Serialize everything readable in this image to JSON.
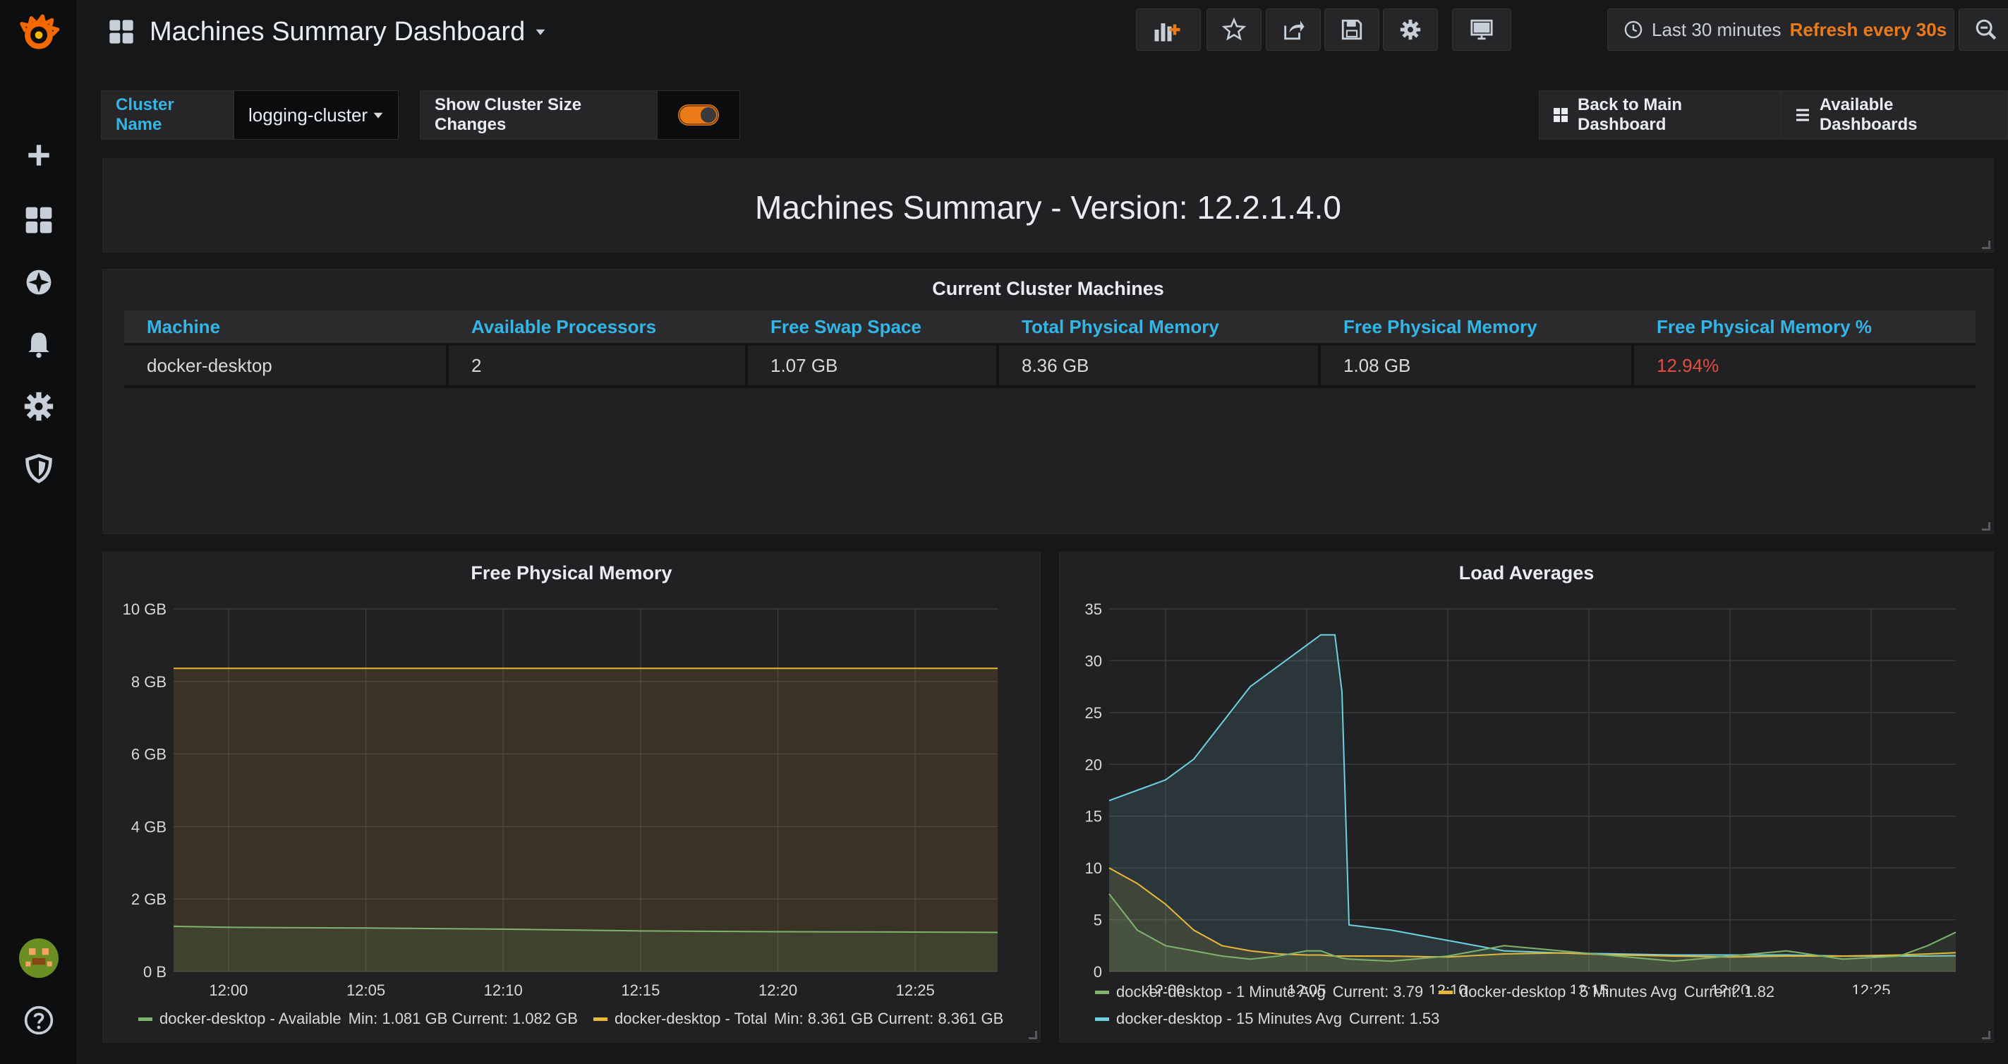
{
  "dashboard": {
    "title": "Machines Summary Dashboard",
    "time_range": "Last 30 minutes",
    "refresh": "Refresh every 30s"
  },
  "variables": {
    "cluster_label": "Cluster Name",
    "cluster_value": "logging-cluster",
    "toggle_label": "Show Cluster Size Changes",
    "toggle_on": true
  },
  "links": {
    "back": "Back to Main Dashboard",
    "available": "Available Dashboards"
  },
  "version_panel": {
    "text": "Machines Summary - Version: 12.2.1.4.0"
  },
  "machines_table": {
    "title": "Current Cluster Machines",
    "columns": [
      "Machine",
      "Available Processors",
      "Free Swap Space",
      "Total Physical Memory",
      "Free Physical Memory",
      "Free Physical Memory %"
    ],
    "rows": [
      [
        "docker-desktop",
        "2",
        "1.07 GB",
        "8.36 GB",
        "1.08 GB",
        "12.94%"
      ]
    ]
  },
  "colors": {
    "green": "#7eb26d",
    "yellow": "#eab839",
    "blue": "#6ed0e0",
    "danger": "#e24d42",
    "orange": "#eb7b18"
  },
  "icons": {
    "sidemenu": [
      "grafana-logo-icon",
      "plus-icon",
      "dashboards-icon",
      "explore-compass-icon",
      "alerting-bell-icon",
      "configuration-gear-icon",
      "server-admin-shield-icon",
      "user-avatar",
      "help-icon"
    ],
    "navbar": [
      "add-panel-icon",
      "star-icon",
      "share-icon",
      "save-icon",
      "settings-icon",
      "tv-mode-icon",
      "clock-icon",
      "zoom-out-icon",
      "refresh-icon"
    ]
  },
  "chart_data": [
    {
      "type": "area",
      "title": "Free Physical Memory",
      "x": [
        "11:58",
        "12:00",
        "12:05",
        "12:10",
        "12:15",
        "12:20",
        "12:25",
        "12:28"
      ],
      "x_ticks": [
        "12:00",
        "12:05",
        "12:10",
        "12:15",
        "12:20",
        "12:25"
      ],
      "y_ticks": [
        "0 B",
        "2 GB",
        "4 GB",
        "6 GB",
        "8 GB",
        "10 GB"
      ],
      "ylim": [
        0,
        10
      ],
      "series": [
        {
          "name": "docker-desktop - Available",
          "color": "#7eb26d",
          "values": [
            1.25,
            1.22,
            1.2,
            1.17,
            1.12,
            1.1,
            1.09,
            1.08
          ],
          "legend": "Min: 1.081 GB  Current: 1.082 GB"
        },
        {
          "name": "docker-desktop - Total",
          "color": "#eab839",
          "values": [
            8.361,
            8.361,
            8.361,
            8.361,
            8.361,
            8.361,
            8.361,
            8.361
          ],
          "legend": "Min: 8.361 GB  Current: 8.361 GB"
        }
      ]
    },
    {
      "type": "line",
      "title": "Load Averages",
      "x": [
        "11:58",
        "11:59",
        "12:00",
        "12:01",
        "12:02",
        "12:03",
        "12:04",
        "12:05",
        "12:05:30",
        "12:06",
        "12:06:15",
        "12:06:30",
        "12:08",
        "12:10",
        "12:12",
        "12:14",
        "12:16",
        "12:18",
        "12:20",
        "12:22",
        "12:24",
        "12:26",
        "12:27",
        "12:28"
      ],
      "x_ticks": [
        "12:00",
        "12:05",
        "12:10",
        "12:15",
        "12:20",
        "12:25"
      ],
      "y_ticks": [
        "0",
        "5",
        "10",
        "15",
        "20",
        "25",
        "30",
        "35"
      ],
      "ylim": [
        0,
        35
      ],
      "series": [
        {
          "name": "docker-desktop - 1 Minute Avg",
          "color": "#7eb26d",
          "values": [
            7.5,
            4,
            2.5,
            2,
            1.5,
            1.2,
            1.5,
            2,
            2,
            1.5,
            1.3,
            1.2,
            1,
            1.5,
            2.5,
            2,
            1.5,
            1,
            1.5,
            2,
            1.2,
            1.5,
            2.5,
            3.79
          ],
          "legend": "Current: 3.79"
        },
        {
          "name": "docker-desktop - 5 Minutes Avg",
          "color": "#eab839",
          "values": [
            10,
            8.5,
            6.5,
            4,
            2.5,
            2,
            1.7,
            1.6,
            1.6,
            1.5,
            1.5,
            1.5,
            1.5,
            1.4,
            1.7,
            1.8,
            1.6,
            1.5,
            1.4,
            1.5,
            1.5,
            1.6,
            1.7,
            1.82
          ],
          "legend": "Current: 1.82"
        },
        {
          "name": "docker-desktop - 15 Minutes Avg",
          "color": "#6ed0e0",
          "values": [
            16.5,
            17.5,
            18.5,
            20.5,
            24,
            27.5,
            29.5,
            31.5,
            32.5,
            32.5,
            27,
            4.5,
            4,
            3,
            2,
            1.8,
            1.7,
            1.6,
            1.6,
            1.6,
            1.5,
            1.5,
            1.5,
            1.53
          ],
          "legend": "Current: 1.53"
        }
      ]
    }
  ]
}
